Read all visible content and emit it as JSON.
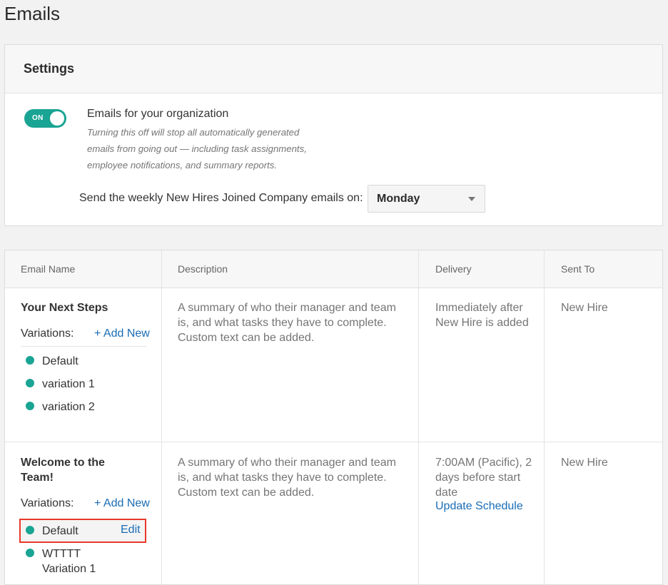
{
  "page": {
    "title": "Emails"
  },
  "settings": {
    "header": "Settings",
    "toggle_label": "ON",
    "org_title": "Emails for your organization",
    "org_desc_lines": [
      "Turning this off will stop all automatically generated",
      "emails from going out — including task assignments,",
      "employee notifications, and summary reports."
    ],
    "weekly_label": "Send the weekly New Hires Joined Company emails on:",
    "weekly_day": "Monday"
  },
  "table": {
    "columns": [
      "Email Name",
      "Description",
      "Delivery",
      "Sent To"
    ],
    "rows": [
      {
        "name": "Your Next Steps",
        "variations_label": "Variations:",
        "add_new": "+ Add New",
        "variations": [
          "Default",
          "variation 1",
          "variation 2"
        ],
        "description_lines": [
          "A summary of who their manager and team",
          "is, and what tasks they have to complete.",
          "Custom text can be added."
        ],
        "delivery_lines": [
          "Immediately after",
          "New Hire is added"
        ],
        "sent_to": "New Hire"
      },
      {
        "name_lines": [
          "Welcome to the",
          "Team!"
        ],
        "variations_label": "Variations:",
        "add_new": "+ Add New",
        "variations": [
          "Default",
          "WTTTT",
          "Variation 1"
        ],
        "edit_label": "Edit",
        "description_lines": [
          "A summary of who their manager and team",
          "is, and what tasks they have to complete.",
          "Custom text can be added."
        ],
        "delivery_lines": [
          "7:00AM (Pacific), 2",
          "days before start",
          "date"
        ],
        "update_schedule": "Update Schedule",
        "sent_to": "New Hire"
      }
    ]
  },
  "colors": {
    "accent": "#1aa493",
    "link": "#1a6db5",
    "highlight": "#e8392b"
  }
}
